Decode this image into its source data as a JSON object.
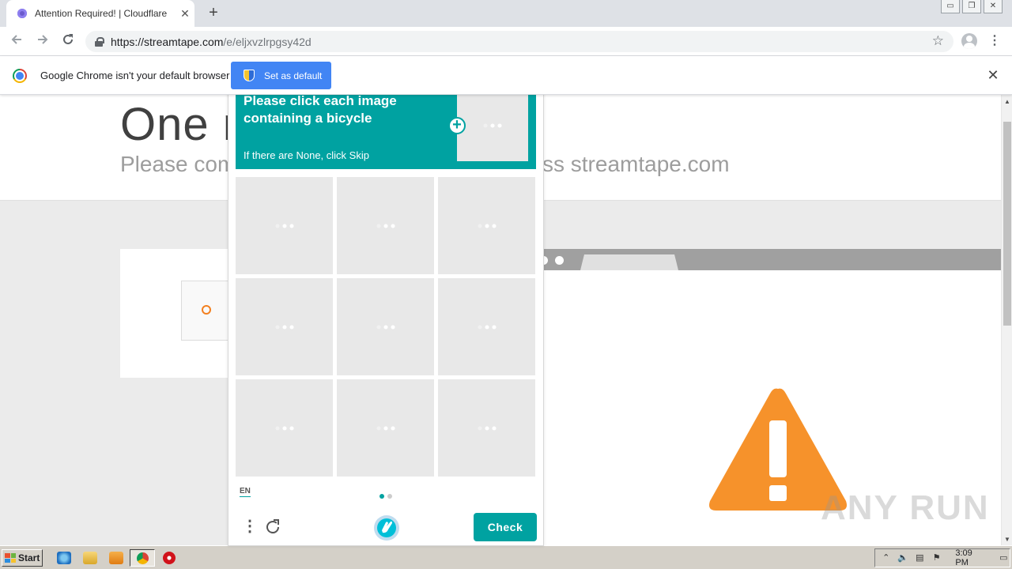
{
  "browser": {
    "tab_title": "Attention Required! | Cloudflare",
    "tab_close": "✕",
    "new_tab": "+",
    "url_host": "https://streamtape.com",
    "url_path": "/e/eljxvzlrpgsy42d",
    "star": "☆",
    "menu": "⋮",
    "window_controls": [
      "▭",
      "❐",
      "✕"
    ]
  },
  "infobar": {
    "message": "Google Chrome isn't your default browser",
    "button_label": "Set as default",
    "close": "✕"
  },
  "page": {
    "heading": "One m",
    "subheading_left": "Please com",
    "subheading_right": "ss streamtape.com"
  },
  "captcha": {
    "prompt_title": "Please click each image containing a bicycle",
    "prompt_sub": "If there are None, click Skip",
    "language": "EN",
    "check_label": "Check",
    "tile_count": 9,
    "pages": 2,
    "current_page": 1
  },
  "watermark": "ANY RUN",
  "taskbar": {
    "start_label": "Start",
    "clock": "3:09 PM"
  },
  "colors": {
    "captcha_teal": "#00a2a1",
    "chrome_blue": "#4285f4",
    "cloudflare_orange": "#f38020",
    "warning_orange": "#f6922b"
  }
}
